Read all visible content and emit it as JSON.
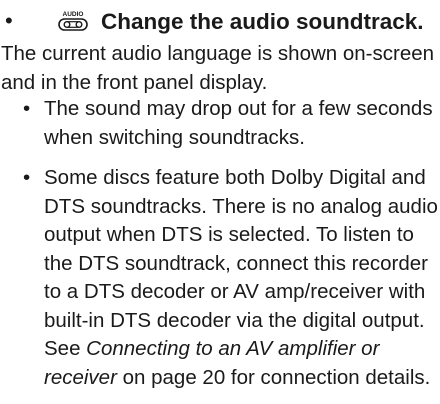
{
  "heading": {
    "bullet": "•",
    "icon": {
      "name": "audio-button-icon",
      "label": "AUDIO"
    },
    "text": "Change the audio soundtrack."
  },
  "intro": "The current audio language is shown on-screen and in the front panel display.",
  "notes": [
    {
      "bullet": "•",
      "text": "The sound may drop out for a few seconds when switching soundtracks."
    },
    {
      "bullet": "•",
      "text_before": "Some discs feature both Dolby Digital and DTS soundtracks. There is no analog audio output when DTS is selected. To listen to the DTS soundtrack, connect this recorder to a DTS decoder or AV amp/receiver with built-in DTS decoder via the digital output. See ",
      "link_text": "Connecting to an AV amplifier or receiver",
      "text_after": " on page 20 for connection details."
    }
  ]
}
